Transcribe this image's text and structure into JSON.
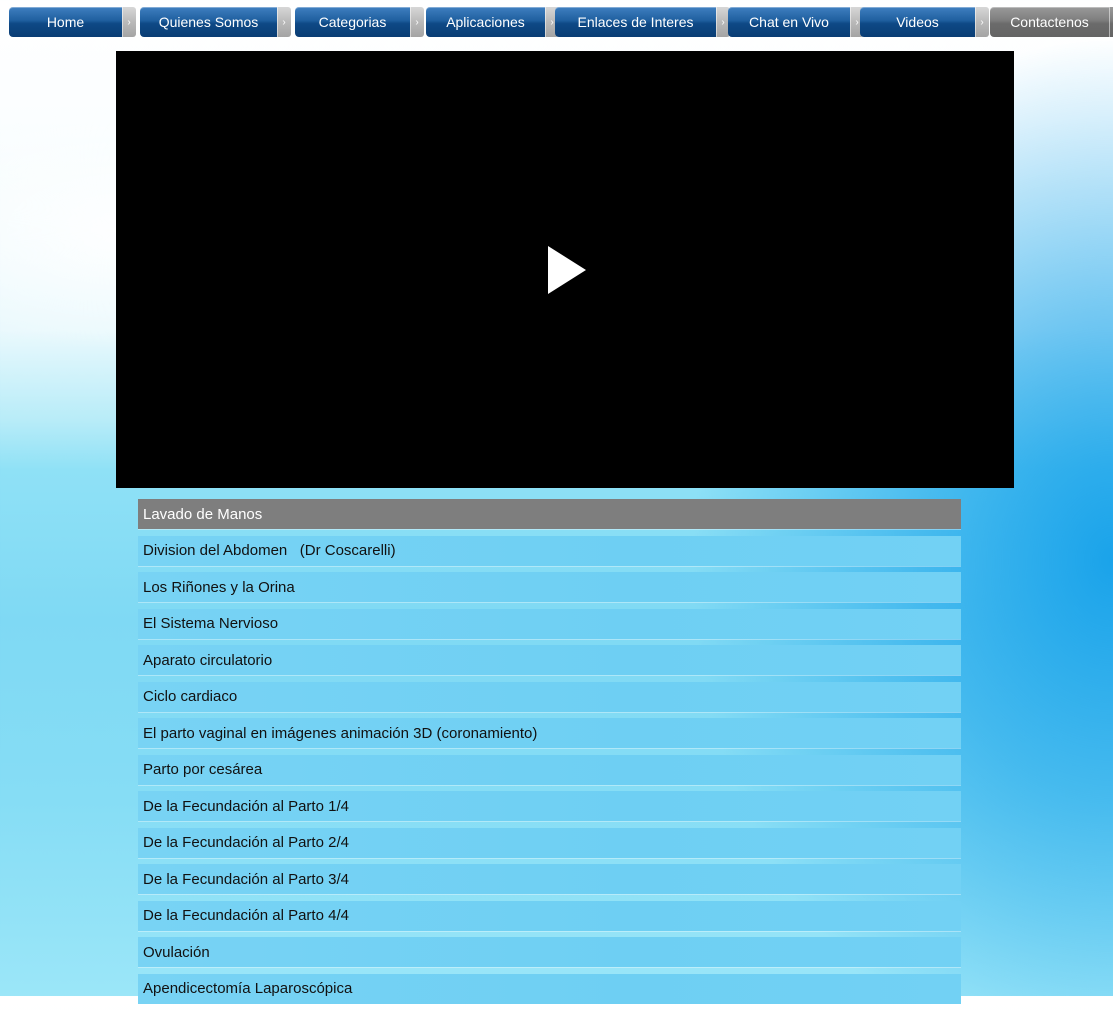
{
  "nav": {
    "items": [
      {
        "label": "Home",
        "active": false
      },
      {
        "label": "Quienes Somos",
        "active": false
      },
      {
        "label": "Categorias",
        "active": false
      },
      {
        "label": "Aplicaciones",
        "active": false
      },
      {
        "label": "Enlaces de Interes",
        "active": false
      },
      {
        "label": "Chat en Vivo",
        "active": false
      },
      {
        "label": "Videos",
        "active": false
      },
      {
        "label": "Contactenos",
        "active": true
      }
    ],
    "arrow_glyph": "›",
    "colors": {
      "button": "#0e4986",
      "active_button": "#7d7d7d",
      "arrow": "#b9b9b9"
    }
  },
  "video": {
    "play_icon": "play-icon",
    "background": "#000000"
  },
  "playlist": {
    "items": [
      {
        "title": "Lavado de Manos",
        "active": true
      },
      {
        "title": "Division del Abdomen   (Dr Coscarelli)",
        "active": false
      },
      {
        "title": "Los Riñones y la Orina",
        "active": false
      },
      {
        "title": "El Sistema Nervioso",
        "active": false
      },
      {
        "title": "Aparato circulatorio",
        "active": false
      },
      {
        "title": "Ciclo cardiaco",
        "active": false
      },
      {
        "title": "El parto vaginal en imágenes animación 3D (coronamiento)",
        "active": false
      },
      {
        "title": "Parto por cesárea",
        "active": false
      },
      {
        "title": "De la Fecundación al Parto 1/4",
        "active": false
      },
      {
        "title": "De la Fecundación al Parto 2/4",
        "active": false
      },
      {
        "title": "De la Fecundación al Parto 3/4",
        "active": false
      },
      {
        "title": "De la Fecundación al Parto 4/4",
        "active": false
      },
      {
        "title": "Ovulación",
        "active": false
      },
      {
        "title": "Apendicectomía Laparoscópica",
        "active": false
      }
    ],
    "colors": {
      "item": "#6ecff3",
      "active_item": "#7e7e7e"
    }
  }
}
